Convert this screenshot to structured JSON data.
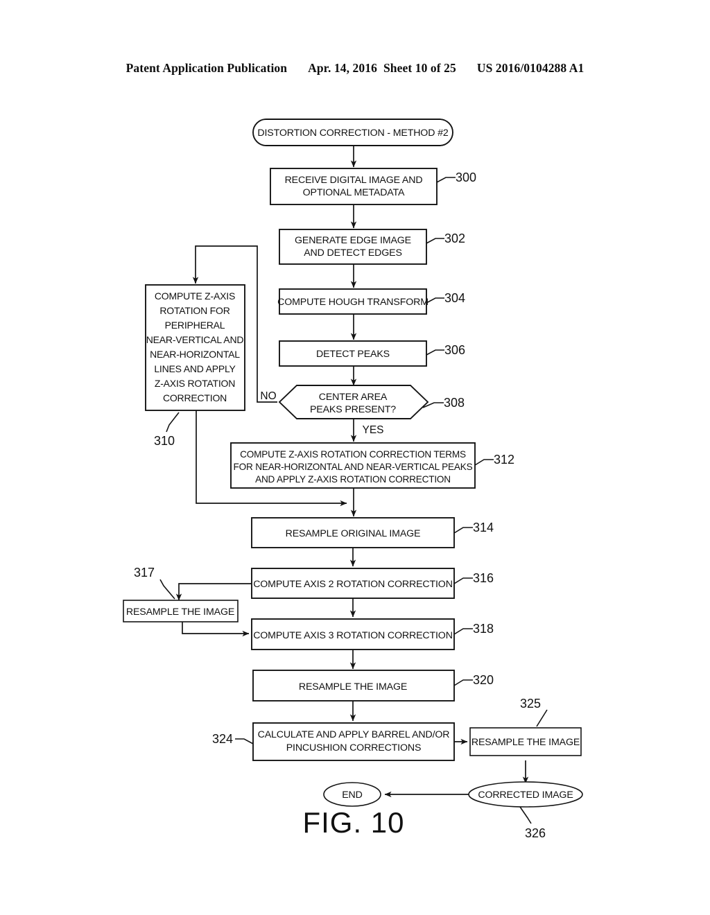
{
  "header": {
    "publication": "Patent Application Publication",
    "date": "Apr. 14, 2016",
    "sheet": "Sheet 10 of 25",
    "pubnumber": "US 2016/0104288 A1"
  },
  "figure": {
    "caption": "FIG. 10",
    "title": "DISTORTION CORRECTION - METHOD #2"
  },
  "nodes": {
    "start": {
      "label": "DISTORTION CORRECTION - METHOD #2",
      "shape": "rounded-terminator"
    },
    "n300": {
      "label_line1": "RECEIVE DIGITAL IMAGE AND",
      "label_line2": "OPTIONAL METADATA",
      "ref": "300",
      "shape": "process"
    },
    "n302": {
      "label_line1": "GENERATE EDGE IMAGE",
      "label_line2": "AND DETECT EDGES",
      "ref": "302",
      "shape": "process"
    },
    "n304": {
      "label_line1": "COMPUTE HOUGH TRANSFORM",
      "ref": "304",
      "shape": "process"
    },
    "n306": {
      "label_line1": "DETECT PEAKS",
      "ref": "306",
      "shape": "process"
    },
    "n308": {
      "label_line1": "CENTER AREA",
      "label_line2": "PEAKS PRESENT?",
      "ref": "308",
      "shape": "decision-hexagon",
      "branch_no": "NO",
      "branch_yes": "YES"
    },
    "n310": {
      "label_line1": "COMPUTE Z-AXIS",
      "label_line2": "ROTATION FOR",
      "label_line3": "PERIPHERAL",
      "label_line4": "NEAR-VERTICAL AND",
      "label_line5": "NEAR-HORIZONTAL",
      "label_line6": "LINES AND APPLY",
      "label_line7": "Z-AXIS ROTATION",
      "label_line8": "CORRECTION",
      "ref": "310",
      "shape": "process"
    },
    "n312": {
      "label_line1": "COMPUTE Z-AXIS ROTATION CORRECTION TERMS",
      "label_line2": "FOR NEAR-HORIZONTAL AND NEAR-VERTICAL PEAKS",
      "label_line3": "AND APPLY Z-AXIS ROTATION CORRECTION",
      "ref": "312",
      "shape": "process"
    },
    "n314": {
      "label_line1": "RESAMPLE ORIGINAL IMAGE",
      "ref": "314",
      "shape": "process"
    },
    "n316": {
      "label_line1": "COMPUTE AXIS 2 ROTATION CORRECTION",
      "ref": "316",
      "shape": "process"
    },
    "n317": {
      "label_line1": "RESAMPLE THE IMAGE",
      "ref": "317",
      "shape": "process"
    },
    "n318": {
      "label_line1": "COMPUTE AXIS 3 ROTATION CORRECTION",
      "ref": "318",
      "shape": "process"
    },
    "n320": {
      "label_line1": "RESAMPLE THE IMAGE",
      "ref": "320",
      "shape": "process"
    },
    "n324": {
      "label_line1": "CALCULATE AND APPLY BARREL AND/OR",
      "label_line2": "PINCUSHION CORRECTIONS",
      "ref": "324",
      "shape": "process"
    },
    "n325": {
      "label_line1": "RESAMPLE THE IMAGE",
      "ref": "325",
      "shape": "process"
    },
    "n326": {
      "label_line1": "CORRECTED IMAGE",
      "ref": "326",
      "shape": "ellipse"
    },
    "end": {
      "label": "END",
      "shape": "ellipse"
    }
  },
  "colors": {
    "ink": "#141414",
    "paper": "#ffffff"
  }
}
